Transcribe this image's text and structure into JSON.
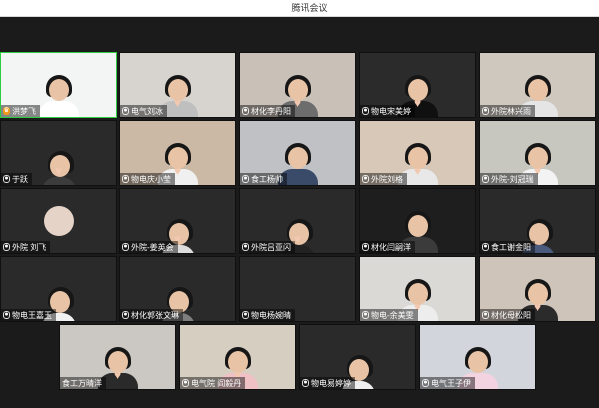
{
  "window": {
    "title": "腾讯会议"
  },
  "icons": {
    "mic": "microphone-icon",
    "host": "host-icon"
  },
  "colors": {
    "active_speaker": "#2ecc40",
    "host_badge": "#f29b1a",
    "tile_bg": "#2a2a2a"
  },
  "participants": [
    {
      "name": "洪梦飞"
    },
    {
      "name": "电气刘冰"
    },
    {
      "name": "材化李丹阳"
    },
    {
      "name": "物电宋美婷"
    },
    {
      "name": "外院林兴雨"
    },
    {
      "name": "于跃"
    },
    {
      "name": "物电庆小莹"
    },
    {
      "name": "食工杨帅"
    },
    {
      "name": "外院刘格"
    },
    {
      "name": "外院-刘冠瑞"
    },
    {
      "name": "外院 刘飞"
    },
    {
      "name": "外院-姜英会"
    },
    {
      "name": "外院吕亚闪"
    },
    {
      "name": "材化闫嗣洋"
    },
    {
      "name": "食工谢金阳"
    },
    {
      "name": "物电王嘉玉"
    },
    {
      "name": "材化郭张文琳"
    },
    {
      "name": "物电杨婉晴"
    },
    {
      "name": "物电-余美雯"
    },
    {
      "name": "材化母松阳"
    },
    {
      "name": "食工万晴洋"
    },
    {
      "name": "电气院 阎毅丹"
    },
    {
      "name": "物电易婷婷"
    },
    {
      "name": "电气王子伊"
    }
  ]
}
